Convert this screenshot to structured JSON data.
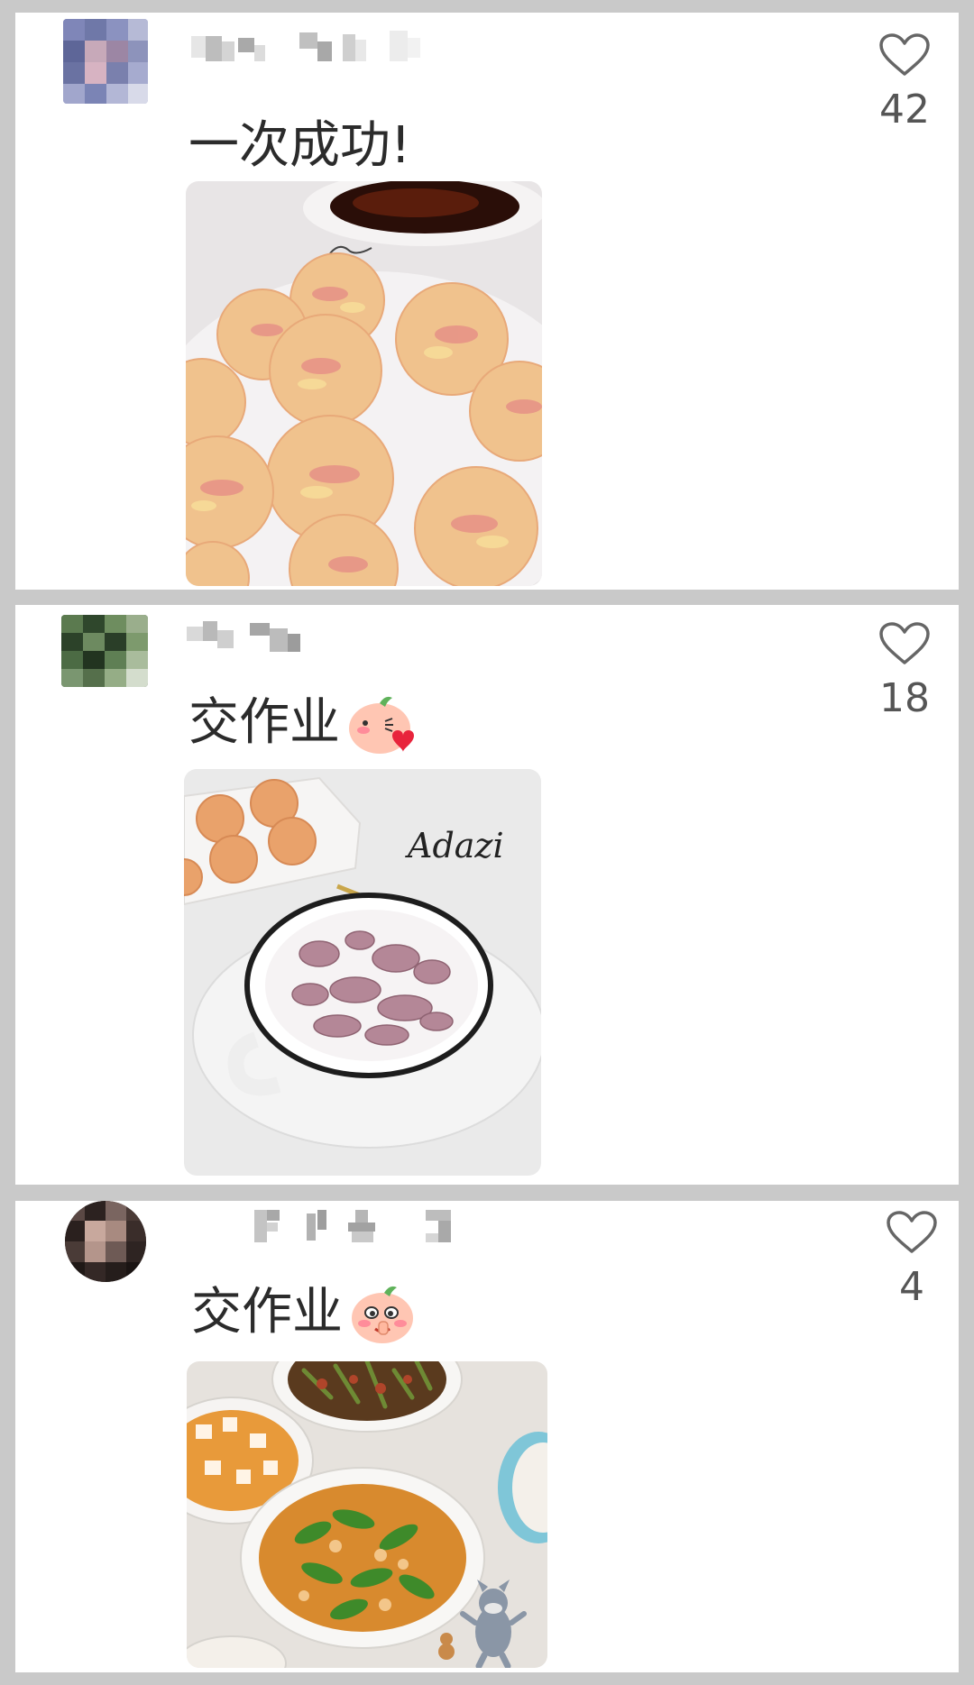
{
  "comments": [
    {
      "text": "一次成功!",
      "likes": "42",
      "emoji": ""
    },
    {
      "text": "交作业",
      "likes": "18",
      "emoji": "peach-blush-heart-emoji"
    },
    {
      "text": "交作业",
      "likes": "4",
      "emoji": "peach-shy-emoji"
    }
  ],
  "photo_watermark": "Adazi",
  "colors": {
    "background": "#c9c9c9",
    "card": "#ffffff",
    "text": "#2b2b2b",
    "like_icon": "#666666"
  }
}
